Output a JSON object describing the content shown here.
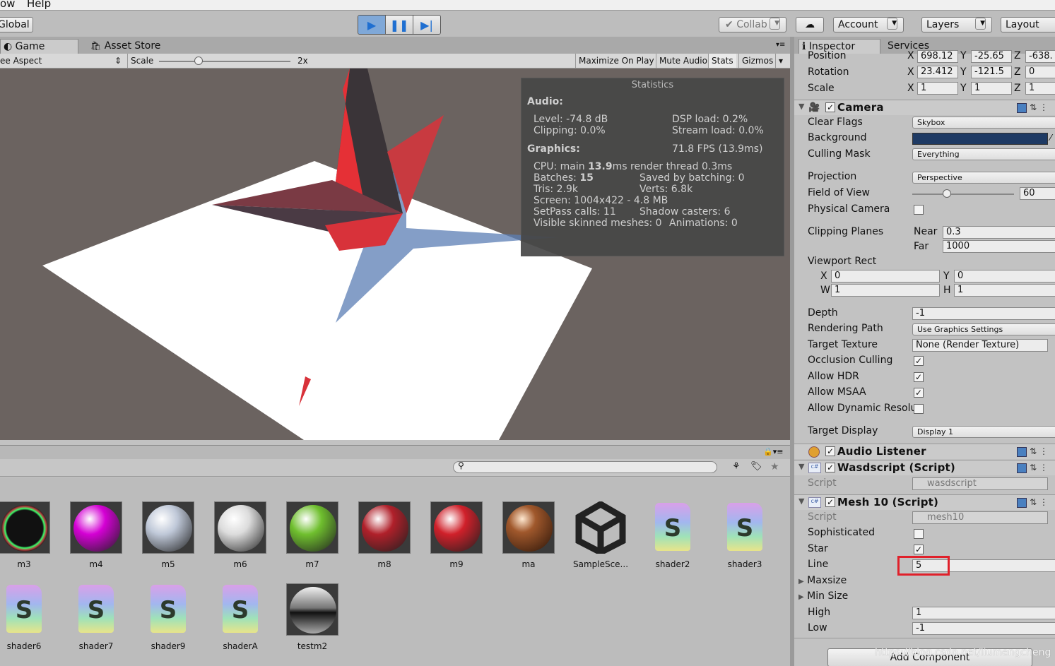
{
  "menu": {
    "items": [
      "ow",
      "Help"
    ]
  },
  "toolbar": {
    "global_label": "Global",
    "collab_label": "Collab",
    "account_label": "Account",
    "layers_label": "Layers",
    "layout_label": "Layout"
  },
  "game_tabs": {
    "game": "Game",
    "asset_store": "Asset Store"
  },
  "game_bar": {
    "aspect": "ee Aspect",
    "scale_label": "Scale",
    "scale_value": "2x",
    "scale_level": 0.3,
    "maximize": "Maximize On Play",
    "mute": "Mute Audio",
    "stats": "Stats",
    "gizmos": "Gizmos"
  },
  "stats": {
    "title": "Statistics",
    "audio_header": "Audio:",
    "level": "Level: -74.8 dB",
    "clipping": "Clipping: 0.0%",
    "dsp": "DSP load: 0.2%",
    "stream": "Stream load: 0.0%",
    "graphics_header": "Graphics:",
    "fps": "71.8 FPS (13.9ms)",
    "cpu_prefix": "CPU: main ",
    "cpu_main": "13.9",
    "cpu_suffix": "ms  render thread 0.3ms",
    "batches_label": "Batches: ",
    "batches": "15",
    "saved": "Saved by batching: 0",
    "tris": "Tris: 2.9k",
    "verts": "Verts: 6.8k",
    "screen": "Screen: 1004x422 - 4.8 MB",
    "setpass": "SetPass calls: 11",
    "shadow": "Shadow casters: 6",
    "skinned": "Visible skinned meshes: 0",
    "animations": "Animations: 0"
  },
  "assets": [
    {
      "name": "m3",
      "kind": "ring"
    },
    {
      "name": "m4",
      "kind": "ball",
      "color": "#d400d4"
    },
    {
      "name": "m5",
      "kind": "ball",
      "color": "#bfc8d8"
    },
    {
      "name": "m6",
      "kind": "ball",
      "color": "#dcdcdc"
    },
    {
      "name": "m7",
      "kind": "ball",
      "color": "#6fbf2e"
    },
    {
      "name": "m8",
      "kind": "ball",
      "color": "#b0202a"
    },
    {
      "name": "m9",
      "kind": "ball",
      "color": "#d0202a"
    },
    {
      "name": "ma",
      "kind": "brick"
    },
    {
      "name": "SampleSce...",
      "kind": "unity"
    },
    {
      "name": "shader2",
      "kind": "shader"
    },
    {
      "name": "shader3",
      "kind": "shader"
    },
    {
      "name": "shader6",
      "kind": "shader"
    },
    {
      "name": "shader7",
      "kind": "shader"
    },
    {
      "name": "shader9",
      "kind": "shader"
    },
    {
      "name": "shaderA",
      "kind": "shader"
    },
    {
      "name": "testm2",
      "kind": "chrome"
    }
  ],
  "inspector": {
    "tab_inspector": "Inspector",
    "tab_services": "Services",
    "transform": {
      "position_label": "Position",
      "position": {
        "x": "698.12",
        "y": "-25.65",
        "z": "-638."
      },
      "rotation_label": "Rotation",
      "rotation": {
        "x": "23.412",
        "y": "-121.5",
        "z": "0"
      },
      "scale_label": "Scale",
      "scale": {
        "x": "1",
        "y": "1",
        "z": "1"
      }
    },
    "camera": {
      "name": "Camera",
      "clear_flags_label": "Clear Flags",
      "clear_flags": "Skybox",
      "background_label": "Background",
      "background_color": "#1e3a64",
      "culling_label": "Culling Mask",
      "culling": "Everything",
      "projection_label": "Projection",
      "projection": "Perspective",
      "fov_label": "Field of View",
      "fov": "60",
      "physical_label": "Physical Camera",
      "clipping_label": "Clipping Planes",
      "near_label": "Near",
      "near": "0.3",
      "far_label": "Far",
      "far": "1000",
      "viewport_label": "Viewport Rect",
      "vx": "0",
      "vy": "0",
      "vw": "1",
      "vh": "1",
      "depth_label": "Depth",
      "depth": "-1",
      "rendering_label": "Rendering Path",
      "rendering": "Use Graphics Settings",
      "target_texture_label": "Target Texture",
      "target_texture": "None (Render Texture)",
      "occlusion_label": "Occlusion Culling",
      "hdr_label": "Allow HDR",
      "msaa_label": "Allow MSAA",
      "dynres_label": "Allow Dynamic Resolu",
      "target_display_label": "Target Display",
      "target_display": "Display 1"
    },
    "audio_listener": "Audio Listener",
    "wasd": {
      "name": "Wasdscript (Script)",
      "script_label": "Script",
      "script": "wasdscript"
    },
    "mesh10": {
      "name": "Mesh 10 (Script)",
      "script_label": "Script",
      "script": "mesh10",
      "sophisticated_label": "Sophisticated",
      "star_label": "Star",
      "line_label": "Line",
      "line": "5",
      "maxsize_label": "Maxsize",
      "minsize_label": "Min Size",
      "high_label": "High",
      "high": "1",
      "low_label": "Low",
      "low": "-1"
    },
    "add_component": "Add Component"
  },
  "watermark": "https://blog.csdn.net/liumengcheng",
  "colors": {
    "highlight_box": "#e0202a",
    "play_active": "#7fa8d8"
  }
}
